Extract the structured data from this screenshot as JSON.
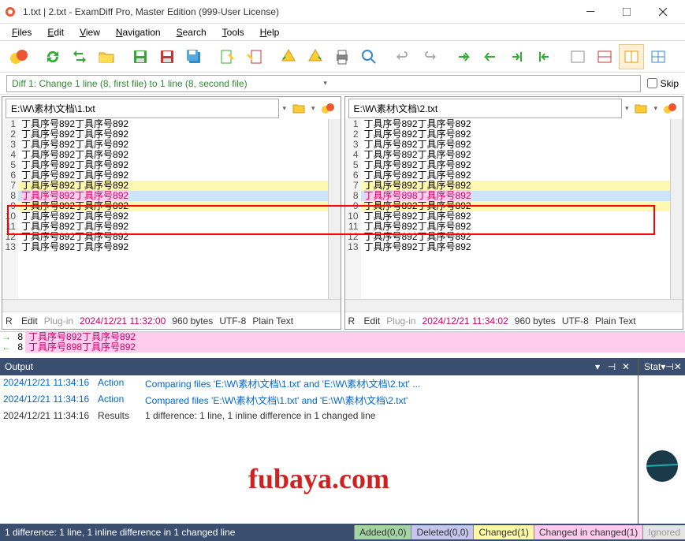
{
  "title": "1.txt | 2.txt - ExamDiff Pro, Master Edition (999-User License)",
  "menu": [
    "Files",
    "Edit",
    "View",
    "Navigation",
    "Search",
    "Tools",
    "Help"
  ],
  "diffmsg": "Diff 1: Change 1 line (8, first file) to 1 line (8, second file)",
  "skip": "Skip",
  "left": {
    "path": "E:\\W\\素材\\文档\\1.txt",
    "lines": [
      "丁具序号892丁具序号892",
      "丁具序号892丁具序号892",
      "丁具序号892丁具序号892",
      "丁具序号892丁具序号892",
      "丁具序号892丁具序号892",
      "丁具序号892丁具序号892",
      "丁具序号892丁具序号892",
      "丁具序号892丁具序号892",
      "丁具序号892丁具序号892",
      "丁具序号892丁具序号892",
      "丁具序号892丁具序号892",
      "丁具序号892丁具序号892",
      "丁具序号892丁具序号892"
    ],
    "info": {
      "r": "R",
      "edit": "Edit",
      "plugin": "Plug-in",
      "ts": "2024/12/21 11:32:00",
      "size": "960 bytes",
      "enc": "UTF-8",
      "type": "Plain Text"
    }
  },
  "right": {
    "path": "E:\\W\\素材\\文档\\2.txt",
    "lines": [
      "丁具序号892丁具序号892",
      "丁具序号892丁具序号892",
      "丁具序号892丁具序号892",
      "丁具序号892丁具序号892",
      "丁具序号892丁具序号892",
      "丁具序号892丁具序号892",
      "丁具序号892丁具序号892",
      "丁具序号898丁具序号892",
      "丁具序号892丁具序号892",
      "丁具序号892丁具序号892",
      "丁具序号892丁具序号892",
      "丁具序号892丁具序号892",
      "丁具序号892丁具序号892"
    ],
    "info": {
      "r": "R",
      "edit": "Edit",
      "plugin": "Plug-in",
      "ts": "2024/12/21 11:34:02",
      "size": "960 bytes",
      "enc": "UTF-8",
      "type": "Plain Text"
    }
  },
  "changes": [
    {
      "arrow": "→",
      "num": "8",
      "txt": "丁具序号892丁具序号892"
    },
    {
      "arrow": "←",
      "num": "8",
      "txt": "丁具序号898丁具序号892"
    }
  ],
  "output": {
    "title": "Output",
    "stat": "Stat",
    "rows": [
      {
        "t": "2024/12/21 11:34:16",
        "a": "Action",
        "m": "Comparing files 'E:\\W\\素材\\文档\\1.txt' and 'E:\\W\\素材\\文档\\2.txt' ..."
      },
      {
        "t": "2024/12/21 11:34:16",
        "a": "Action",
        "m": "Compared files 'E:\\W\\素材\\文档\\1.txt' and 'E:\\W\\素材\\文档\\2.txt'"
      },
      {
        "t": "2024/12/21 11:34:16",
        "a": "Results",
        "m": "1 difference: 1 line, 1 inline difference in 1 changed line",
        "res": true
      }
    ],
    "watermark": "fubaya.com"
  },
  "status": {
    "msg": "1 difference: 1 line, 1 inline difference in 1 changed line",
    "added": "Added(0,0)",
    "deleted": "Deleted(0,0)",
    "changed": "Changed(1)",
    "chginchg": "Changed in changed(1)",
    "ignored": "Ignored"
  }
}
